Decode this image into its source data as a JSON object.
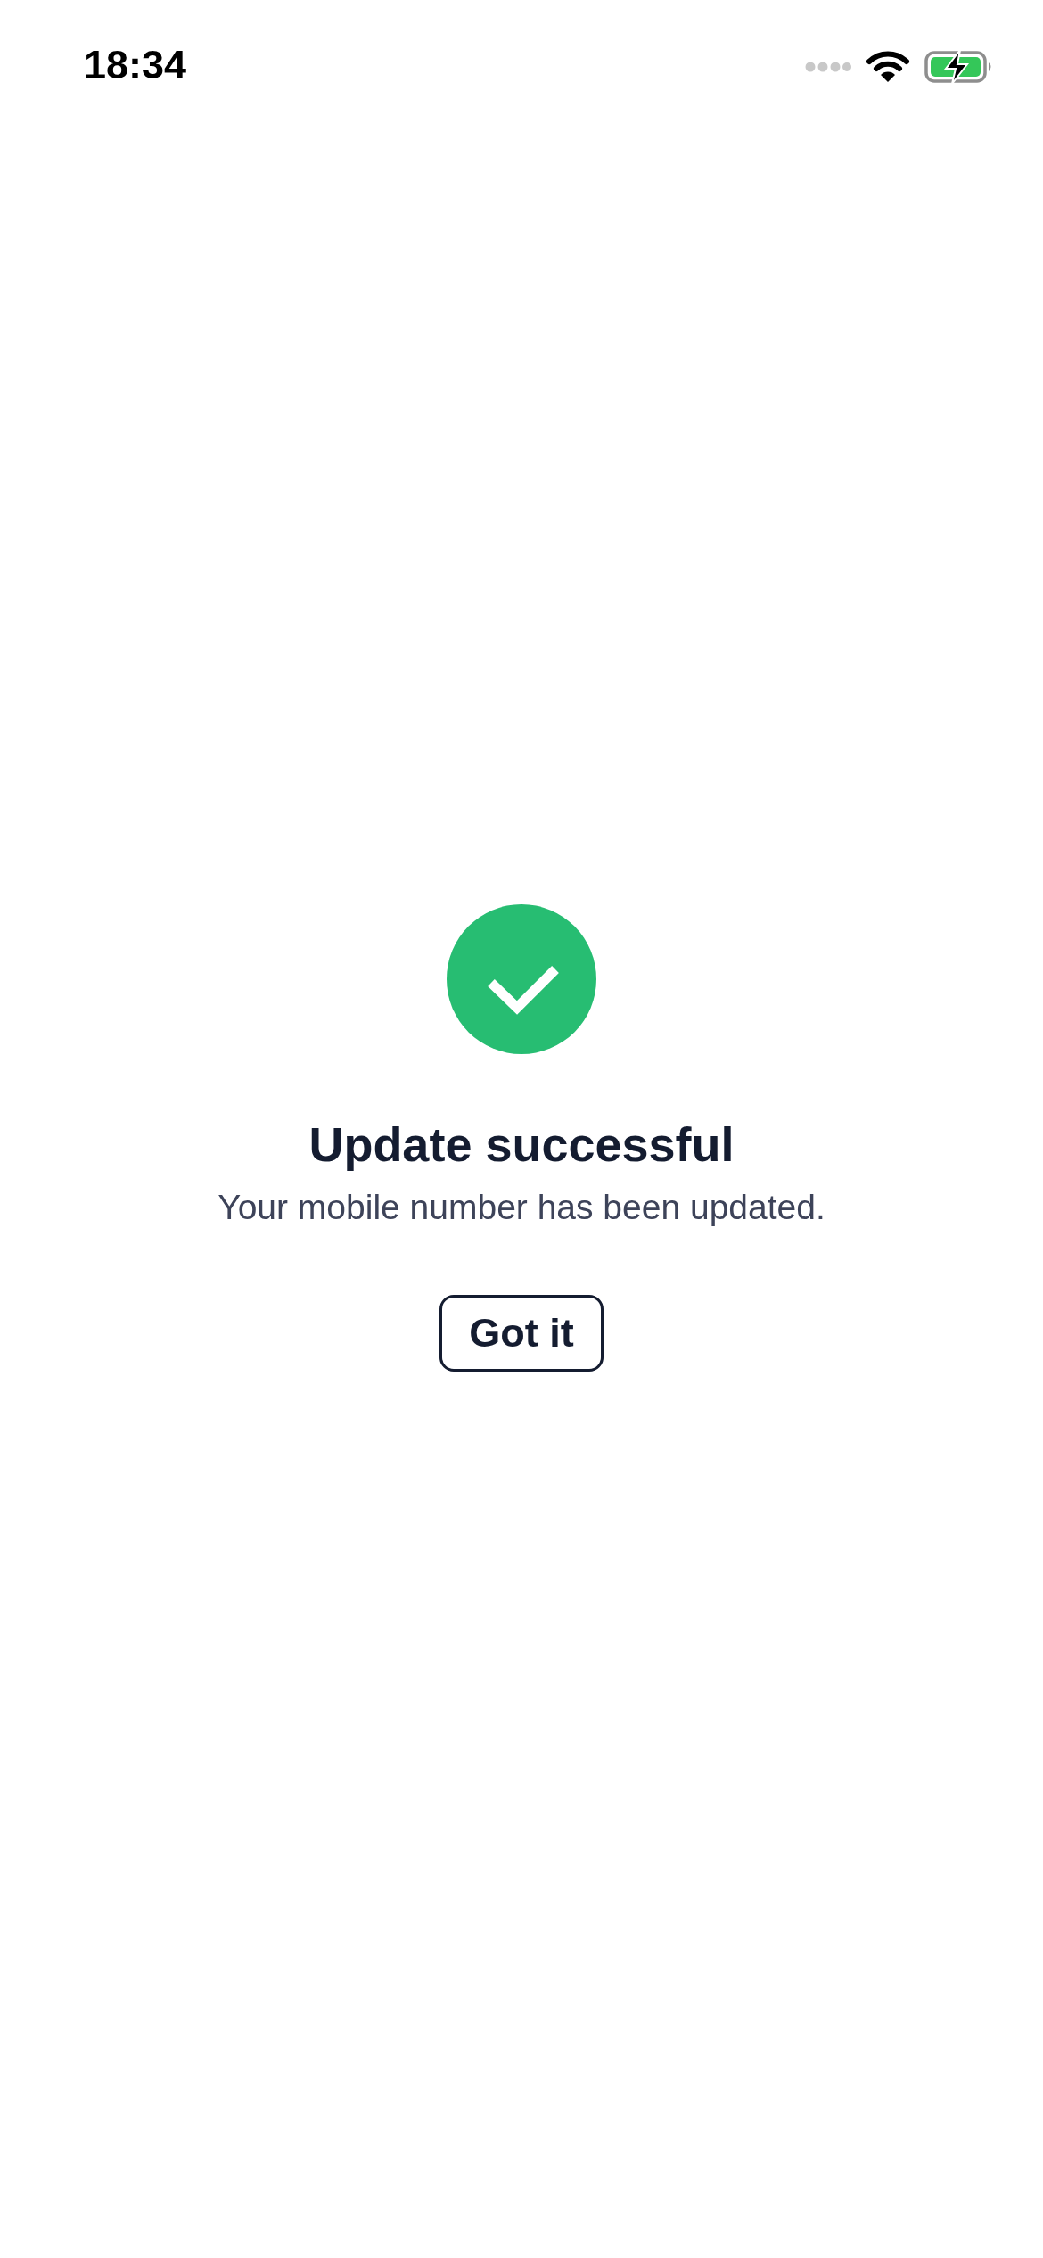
{
  "status_bar": {
    "time": "18:34"
  },
  "result": {
    "title": "Update successful",
    "message": "Your mobile number has been updated.",
    "button": "Got it"
  }
}
